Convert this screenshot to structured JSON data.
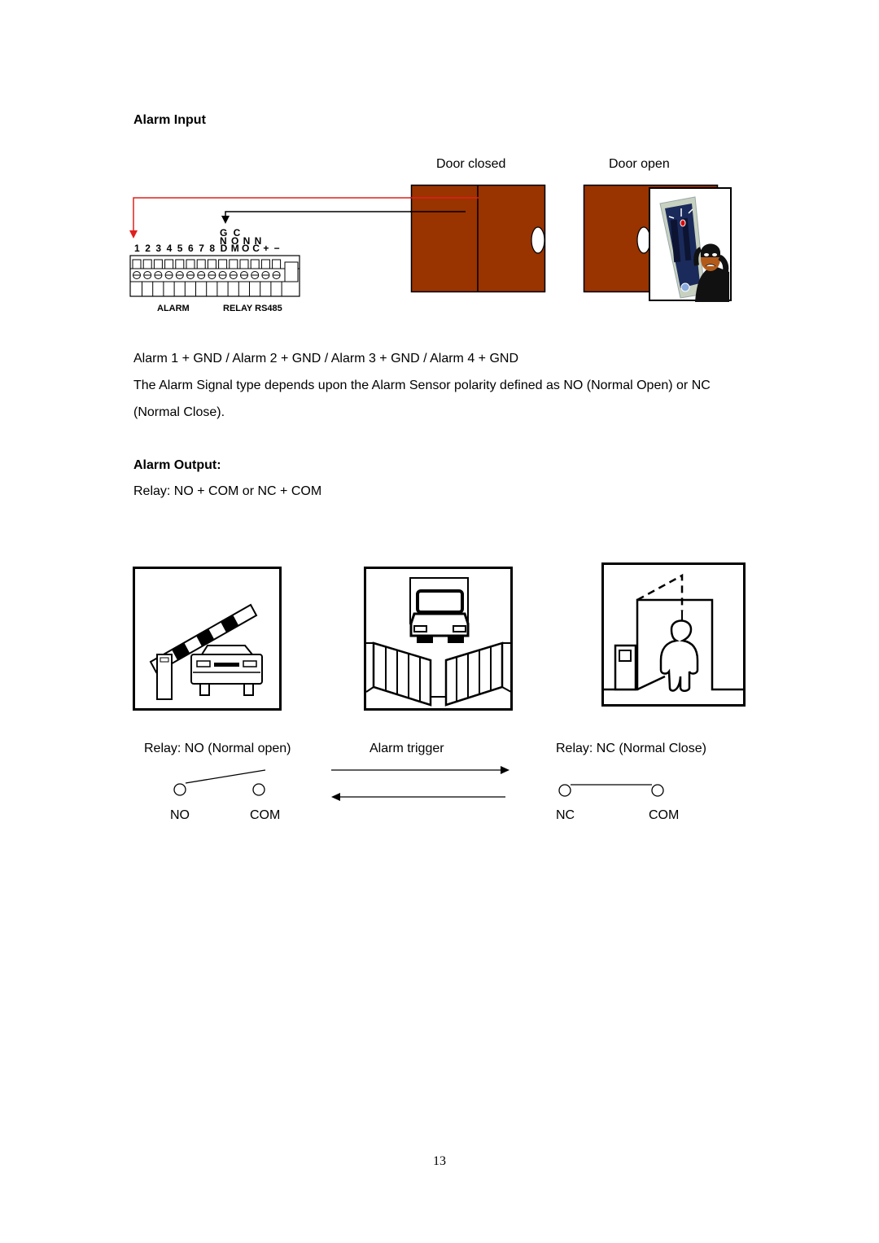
{
  "sections": {
    "alarm_input": {
      "heading": "Alarm Input",
      "door_closed_label": "Door closed",
      "door_open_label": "Door open",
      "connector": {
        "top_labels_row1": "G C",
        "top_labels_row2": "N O N N",
        "pin_labels": [
          "1",
          "2",
          "3",
          "4",
          "5",
          "6",
          "7",
          "8",
          "D",
          "M",
          "O",
          "C",
          "+",
          "−"
        ],
        "group_labels": [
          "ALARM",
          "RELAY RS485"
        ]
      },
      "wire_colors": {
        "signal": "#e0201c",
        "ground": "#000000"
      },
      "door_color": "#993300",
      "line1": "Alarm 1 + GND / Alarm 2 + GND / Alarm 3 + GND / Alarm 4 + GND",
      "description": "The Alarm Signal type depends upon the Alarm Sensor polarity defined as NO (Normal Open) or NC (Normal Close)."
    },
    "alarm_output": {
      "heading": "Alarm Output:",
      "relay_line": "Relay: NO + COM or NC + COM",
      "illustrations": [
        {
          "name": "barrier-gate-car"
        },
        {
          "name": "sliding-gate-truck"
        },
        {
          "name": "door-person"
        }
      ],
      "relay_no_label": "Relay: NO (Normal open)",
      "alarm_trigger_label": "Alarm trigger",
      "relay_nc_label": "Relay: NC (Normal Close)",
      "no_terminals": [
        "NO",
        "COM"
      ],
      "nc_terminals": [
        "NC",
        "COM"
      ]
    }
  },
  "page_number": "13"
}
